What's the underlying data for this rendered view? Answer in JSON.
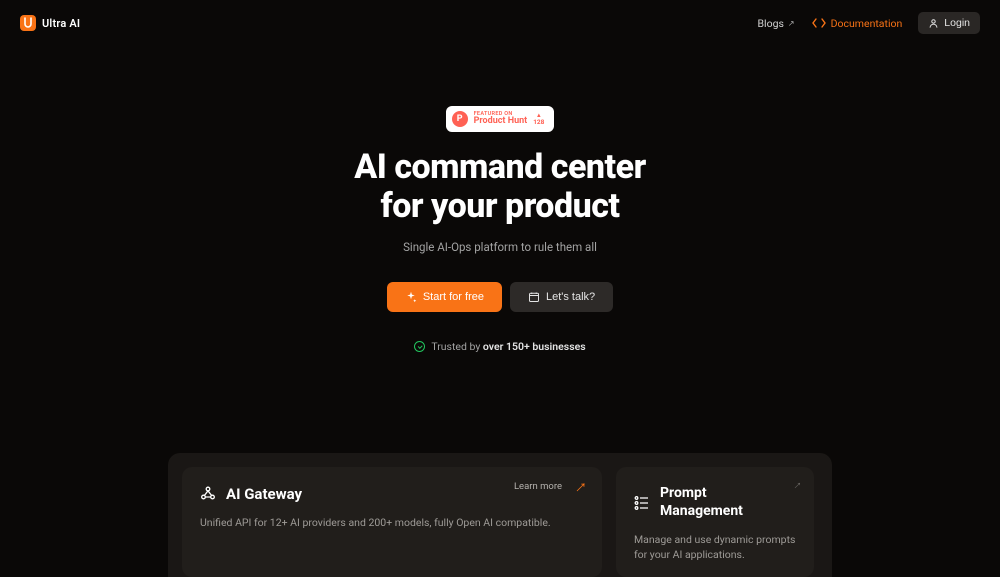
{
  "brand": {
    "name": "Ultra AI"
  },
  "nav": {
    "blogs": "Blogs",
    "docs": "Documentation",
    "login": "Login"
  },
  "product_hunt": {
    "eyebrow": "FEATURED ON",
    "name": "Product Hunt",
    "votes": "128"
  },
  "hero": {
    "title_line1": "AI command center",
    "title_line2": "for your product",
    "subtitle": "Single AI-Ops platform to rule them all",
    "primary_cta": "Start for free",
    "secondary_cta": "Let's talk?",
    "trust_prefix": "Trusted by ",
    "trust_strong": "over 150+ businesses"
  },
  "cards": {
    "gateway": {
      "title": "AI Gateway",
      "desc": "Unified API for 12+ AI providers and 200+ models, fully Open AI compatible.",
      "learn": "Learn more"
    },
    "prompt": {
      "title_line1": "Prompt",
      "title_line2": "Management",
      "desc": "Manage and use dynamic prompts for your AI applications."
    }
  },
  "colors": {
    "accent": "#f97316"
  }
}
